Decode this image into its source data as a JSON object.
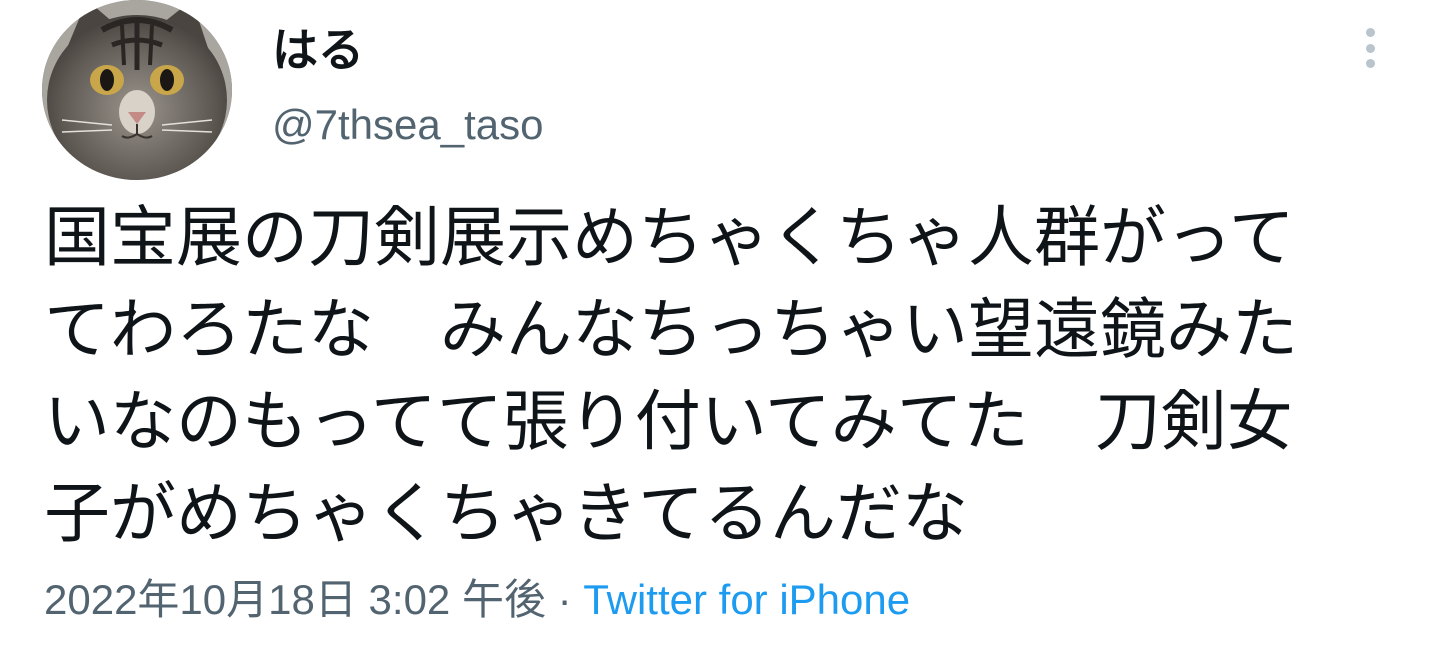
{
  "tweet": {
    "author": {
      "display_name": "はる",
      "handle": "@7thsea_taso",
      "avatar_icon": "cat-avatar-icon"
    },
    "more_icon": "more-vertical-icon",
    "text_lines": [
      "国宝展の刀剣展示めちゃくちゃ人群がって",
      "てわろたな　みんなちっちゃい望遠鏡みた",
      "いなのもってて張り付いてみてた　刀剣女",
      "子がめちゃくちゃきてるんだな"
    ],
    "timestamp": "2022年10月18日 3:02 午後",
    "separator": "·",
    "source": "Twitter for iPhone"
  },
  "colors": {
    "text_primary": "#0f1419",
    "text_secondary": "#536471",
    "link": "#1d9bf0"
  }
}
